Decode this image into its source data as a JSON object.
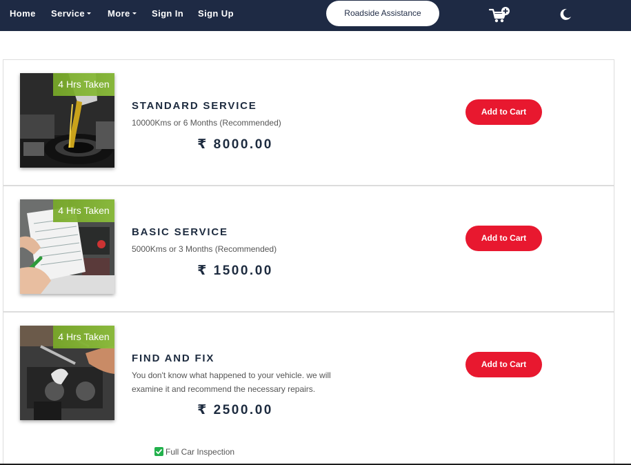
{
  "navbar": {
    "items": [
      {
        "label": "Home",
        "has_dropdown": false
      },
      {
        "label": "Service",
        "has_dropdown": true
      },
      {
        "label": "More",
        "has_dropdown": true
      },
      {
        "label": "Sign In",
        "has_dropdown": false
      },
      {
        "label": "Sign Up",
        "has_dropdown": false
      }
    ],
    "roadside_label": "Roadside Assistance",
    "cart_icon": "cart-add-icon",
    "theme_icon": "moon-icon",
    "background": "#1e2a44"
  },
  "services": [
    {
      "badge": "4 Hrs Taken",
      "title": "STANDARD SERVICE",
      "subtitle": "10000Kms or 6 Months (Recommended)",
      "price": "₹ 8000.00",
      "button_label": "Add to Cart",
      "image": "oil-pour-image"
    },
    {
      "badge": "4 Hrs Taken",
      "title": "BASIC SERVICE",
      "subtitle": "5000Kms or 3 Months (Recommended)",
      "price": "₹ 1500.00",
      "button_label": "Add to Cart",
      "image": "checklist-engine-image"
    },
    {
      "badge": "4 Hrs Taken",
      "title": "FIND AND FIX",
      "description": "You don't know what happened to your vehicle. we will examine it and recommend the necessary repairs.",
      "price": "₹ 2500.00",
      "button_label": "Add to Cart",
      "image": "mechanic-repair-image",
      "features": [
        "Full Car Inspection"
      ]
    }
  ],
  "colors": {
    "accent": "#e8182f",
    "badge": "#8cbe3c",
    "check": "#22b14c",
    "text": "#1d2b3f"
  }
}
